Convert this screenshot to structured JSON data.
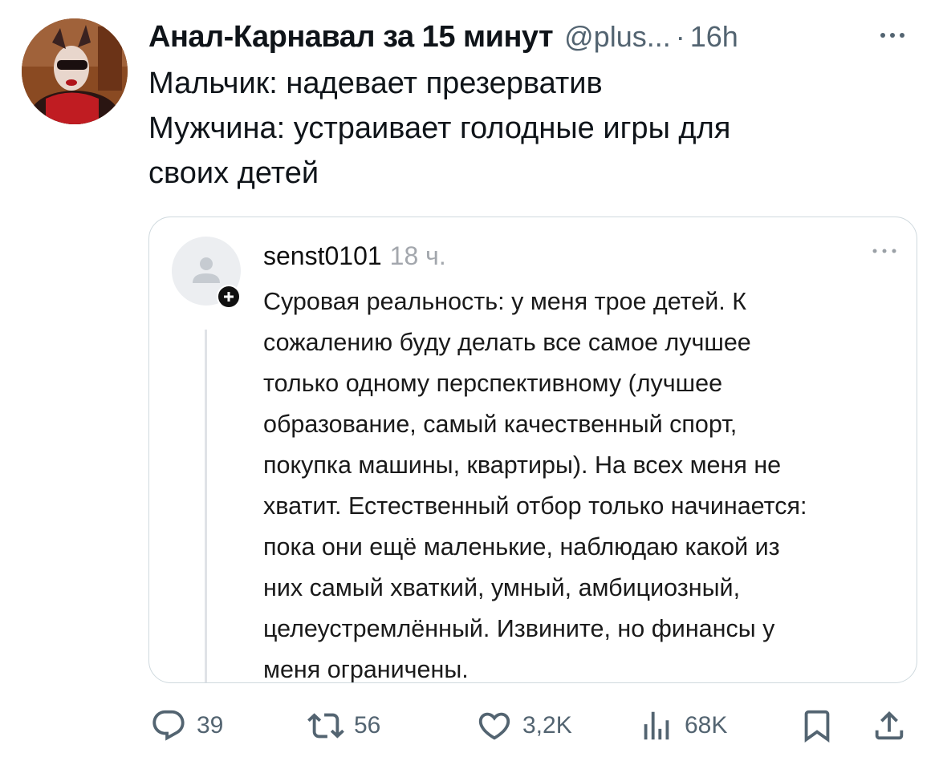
{
  "tweet": {
    "display_name": "Анал-Карнавал за 15 минут",
    "handle": "@plus...",
    "separator": "·",
    "time": "16h",
    "text_lines": [
      "Мальчик: надевает презерватив",
      "Мужчина: устраивает голодные игры для",
      "своих детей"
    ]
  },
  "quote": {
    "username": "senst0101",
    "time": "18 ч.",
    "text_lines": [
      "Суровая реальность: у меня трое детей. К",
      "сожалению буду делать все самое лучшее",
      "только одному перспективному (лучшее",
      "образование, самый качественный спорт,",
      "покупка машины, квартиры). На всех меня не",
      "хватит. Естественный отбор только начинается:",
      "пока они ещё маленькие, наблюдаю какой из",
      "них самый хваткий, умный, амбициозный,",
      "целеустремлённый. Извините, но финансы у",
      "меня ограничены."
    ]
  },
  "actions": {
    "replies": "39",
    "retweets": "56",
    "likes": "3,2K",
    "views": "68K"
  },
  "colors": {
    "text": "#0f1419",
    "muted": "#536471",
    "border": "#cfd9de"
  }
}
